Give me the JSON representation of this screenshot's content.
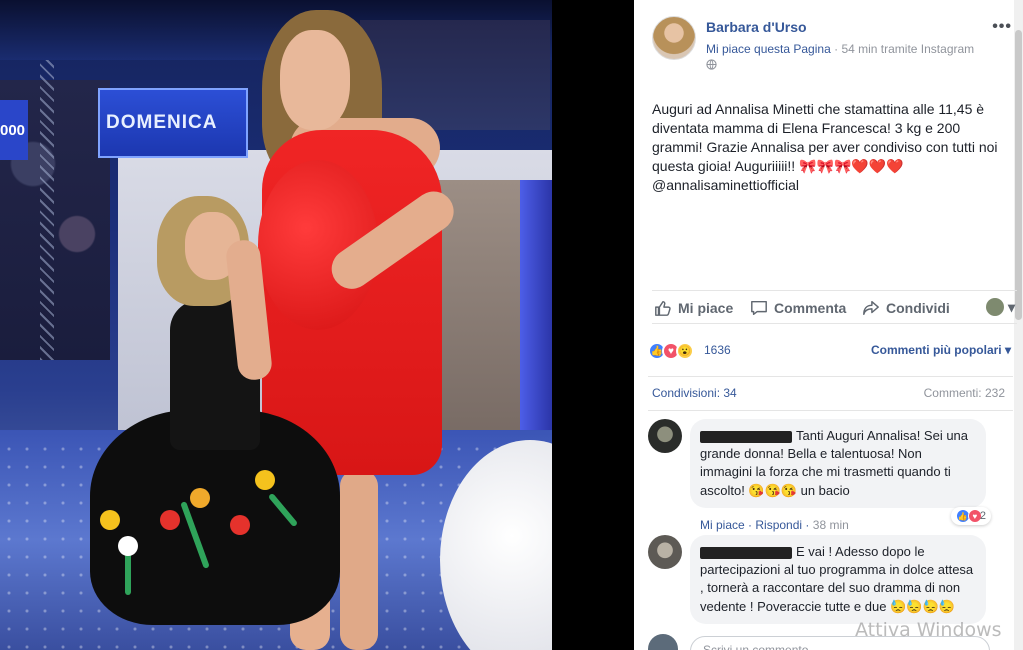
{
  "photo": {
    "screen_text_left": "DOMENICA",
    "screen_text_edge": "000"
  },
  "post": {
    "page_name": "Barbara d'Urso",
    "like_page": "Mi piace questa Pagina",
    "meta_time": "54 min tramite Instagram",
    "privacy_icon": "globe-icon",
    "more": "•••",
    "text": "Auguri ad Annalisa Minetti che stamattina alle 11,45 è diventata mamma di Elena Francesca! 3 kg e 200 grammi! Grazie Annalisa per aver condiviso con tutti noi questa gioia! Auguriiiii!! 🎀🎀🎀❤️❤️❤️ @annalisaminettiofficial"
  },
  "actions": {
    "like": "Mi piace",
    "comment": "Commenta",
    "share": "Condividi",
    "viewer_caret": "▾"
  },
  "reactions": {
    "count": "1636",
    "sort_label": "Commenti più popolari ▾"
  },
  "counts": {
    "shares": "Condivisioni: 34",
    "comments": "Commenti: 232"
  },
  "comments": [
    {
      "text": "Tanti Auguri Annalisa! Sei una grande donna! Bella e talentuosa! Non immagini la forza che mi trasmetti quando ti ascolto! 😘😘😘 un bacio",
      "like": "Mi piace",
      "reply": "Rispondi",
      "time": "38 min",
      "reactions": "2"
    },
    {
      "text": "E vai ! Adesso dopo le partecipazioni al tuo programma in dolce attesa , tornerà a raccontare del suo dramma di non vedente ! Poveraccie tutte e due 😓😓😓😓"
    }
  ],
  "write_comment": {
    "placeholder": "Scrivi un commento..."
  },
  "watermark": "Attiva Windows",
  "colors": {
    "link": "#365899",
    "dress": "#e01c1c",
    "panel_bg": "#ffffff"
  }
}
